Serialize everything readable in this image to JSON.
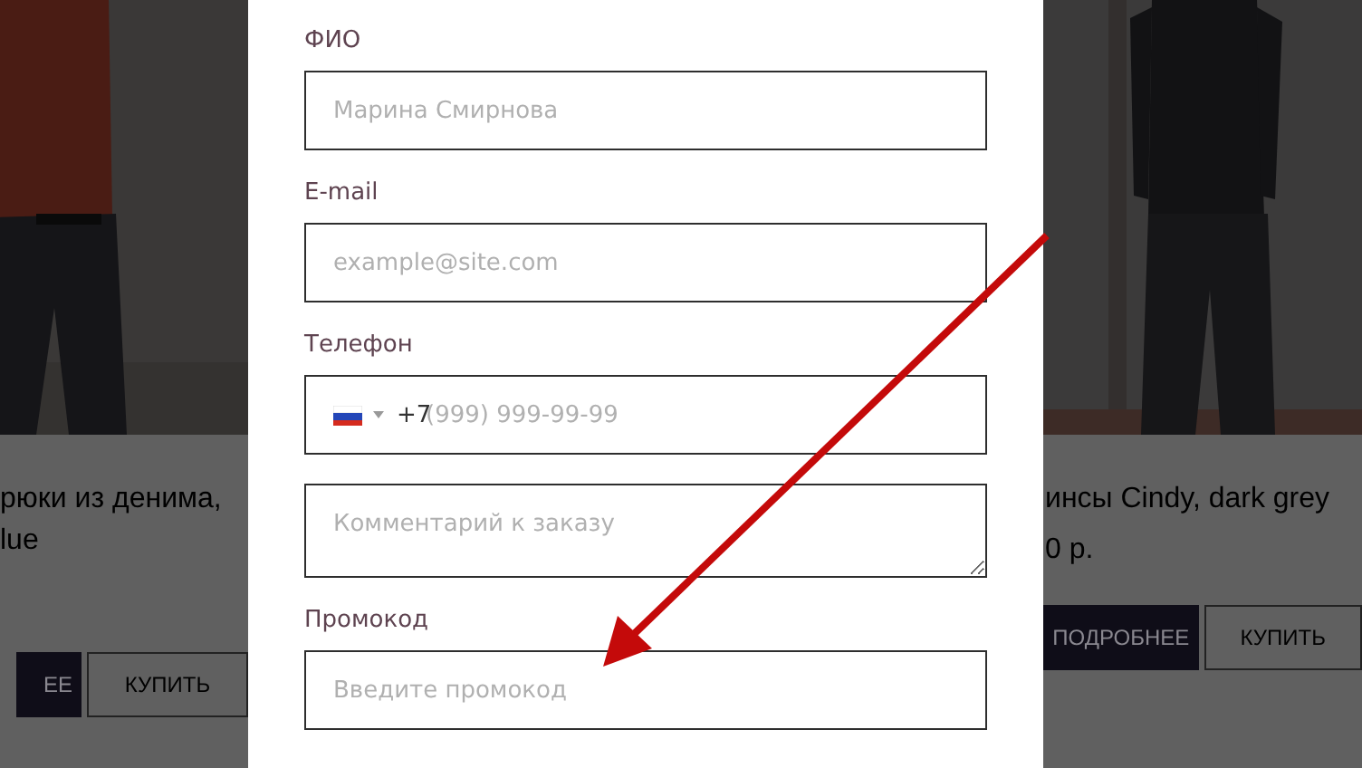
{
  "background_cards": [
    {
      "title_lines": [
        "рюки из денима,",
        "lue"
      ],
      "buttons": [
        {
          "label": "ЕЕ",
          "kind": "primary"
        },
        {
          "label": "КУПИТЬ",
          "kind": "outline"
        }
      ]
    },
    {
      "title_lines": [
        "инсы Cindy, dark grey"
      ],
      "price": "0 р.",
      "buttons": [
        {
          "label": "ПОДРОБНЕЕ",
          "kind": "primary"
        },
        {
          "label": "КУПИТЬ",
          "kind": "outline"
        }
      ]
    }
  ],
  "order_form": {
    "fields": [
      {
        "kind": "text",
        "label": "ФИО",
        "placeholder": "Марина Смирнова"
      },
      {
        "kind": "text",
        "label": "E-mail",
        "placeholder": "example@site.com"
      },
      {
        "kind": "phone",
        "label": "Телефон",
        "prefix": "+7",
        "placeholder": "(999) 999-99-99"
      },
      {
        "kind": "textarea",
        "placeholder": "Комментарий к заказу"
      },
      {
        "kind": "text",
        "label": "Промокод",
        "placeholder": "Введите промокод"
      }
    ]
  }
}
